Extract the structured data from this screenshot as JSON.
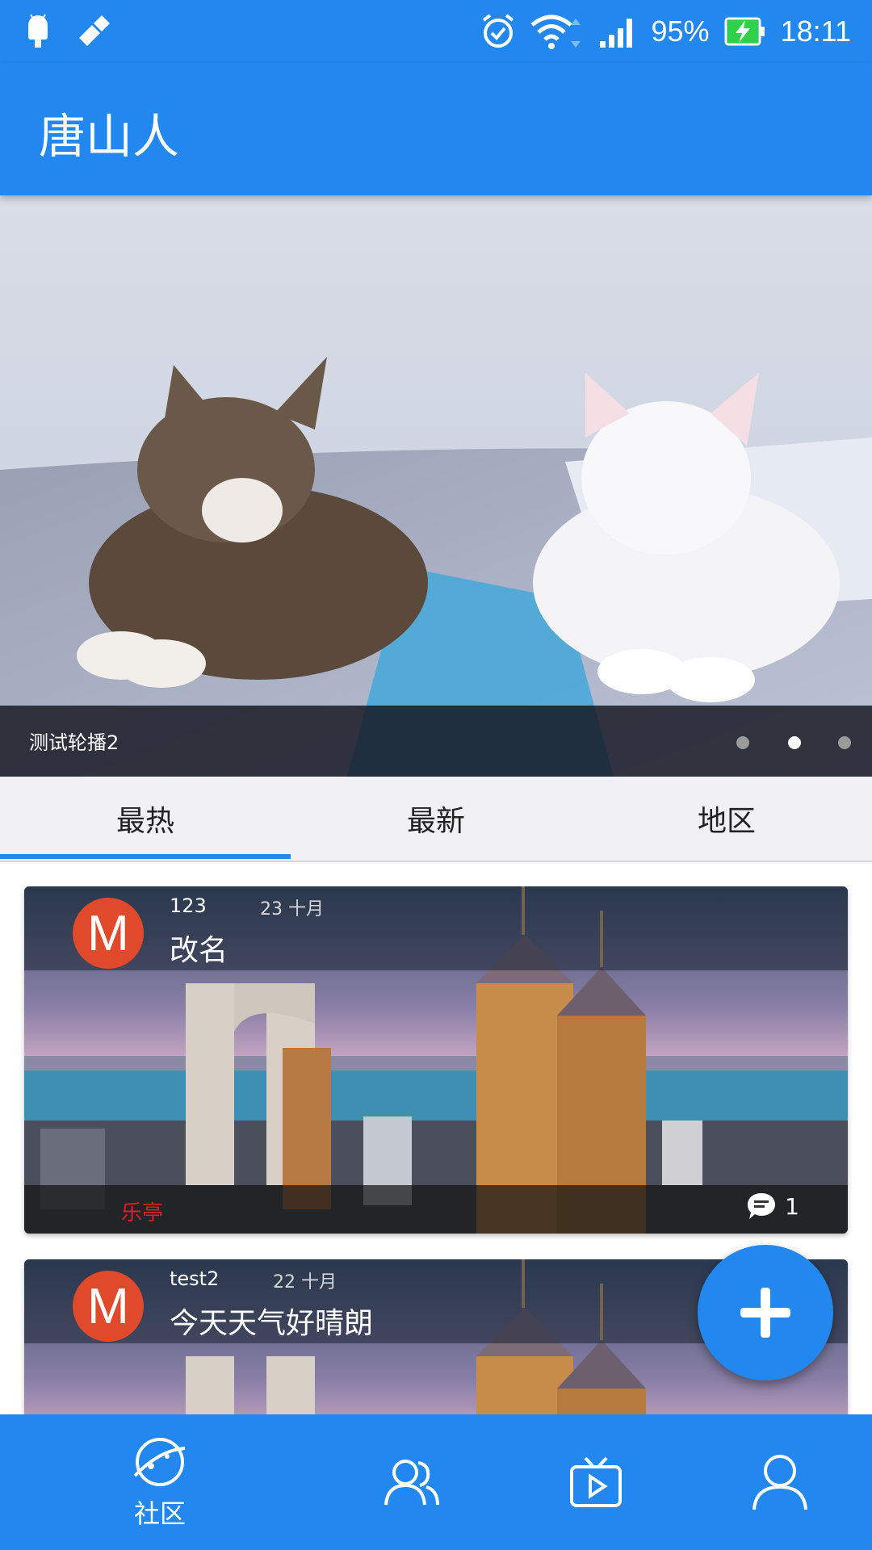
{
  "status_bar": {
    "battery": "95%",
    "time": "18:11"
  },
  "app_bar": {
    "title": "唐山人"
  },
  "banner": {
    "caption": "测试轮播2",
    "slide_count": 3,
    "active_slide": 2
  },
  "tabs": [
    {
      "label": "最热",
      "selected": true
    },
    {
      "label": "最新",
      "selected": false
    },
    {
      "label": "地区",
      "selected": false
    }
  ],
  "posts": [
    {
      "avatar_letter": "M",
      "username": "123",
      "date": "23 十月",
      "title": "改名",
      "tag": "乐亭",
      "comment_count": "1"
    },
    {
      "avatar_letter": "M",
      "username": "test2",
      "date": "22 十月",
      "title": "今天天气好晴朗"
    }
  ],
  "bottom_nav": [
    {
      "icon": "planet-icon",
      "label": "社区",
      "active": true
    },
    {
      "icon": "people-icon",
      "label": ""
    },
    {
      "icon": "tv-play-icon",
      "label": ""
    },
    {
      "icon": "person-icon",
      "label": ""
    }
  ],
  "colors": {
    "primary": "#2288f0",
    "avatar": "#e04a2a",
    "tag": "#e02020"
  }
}
